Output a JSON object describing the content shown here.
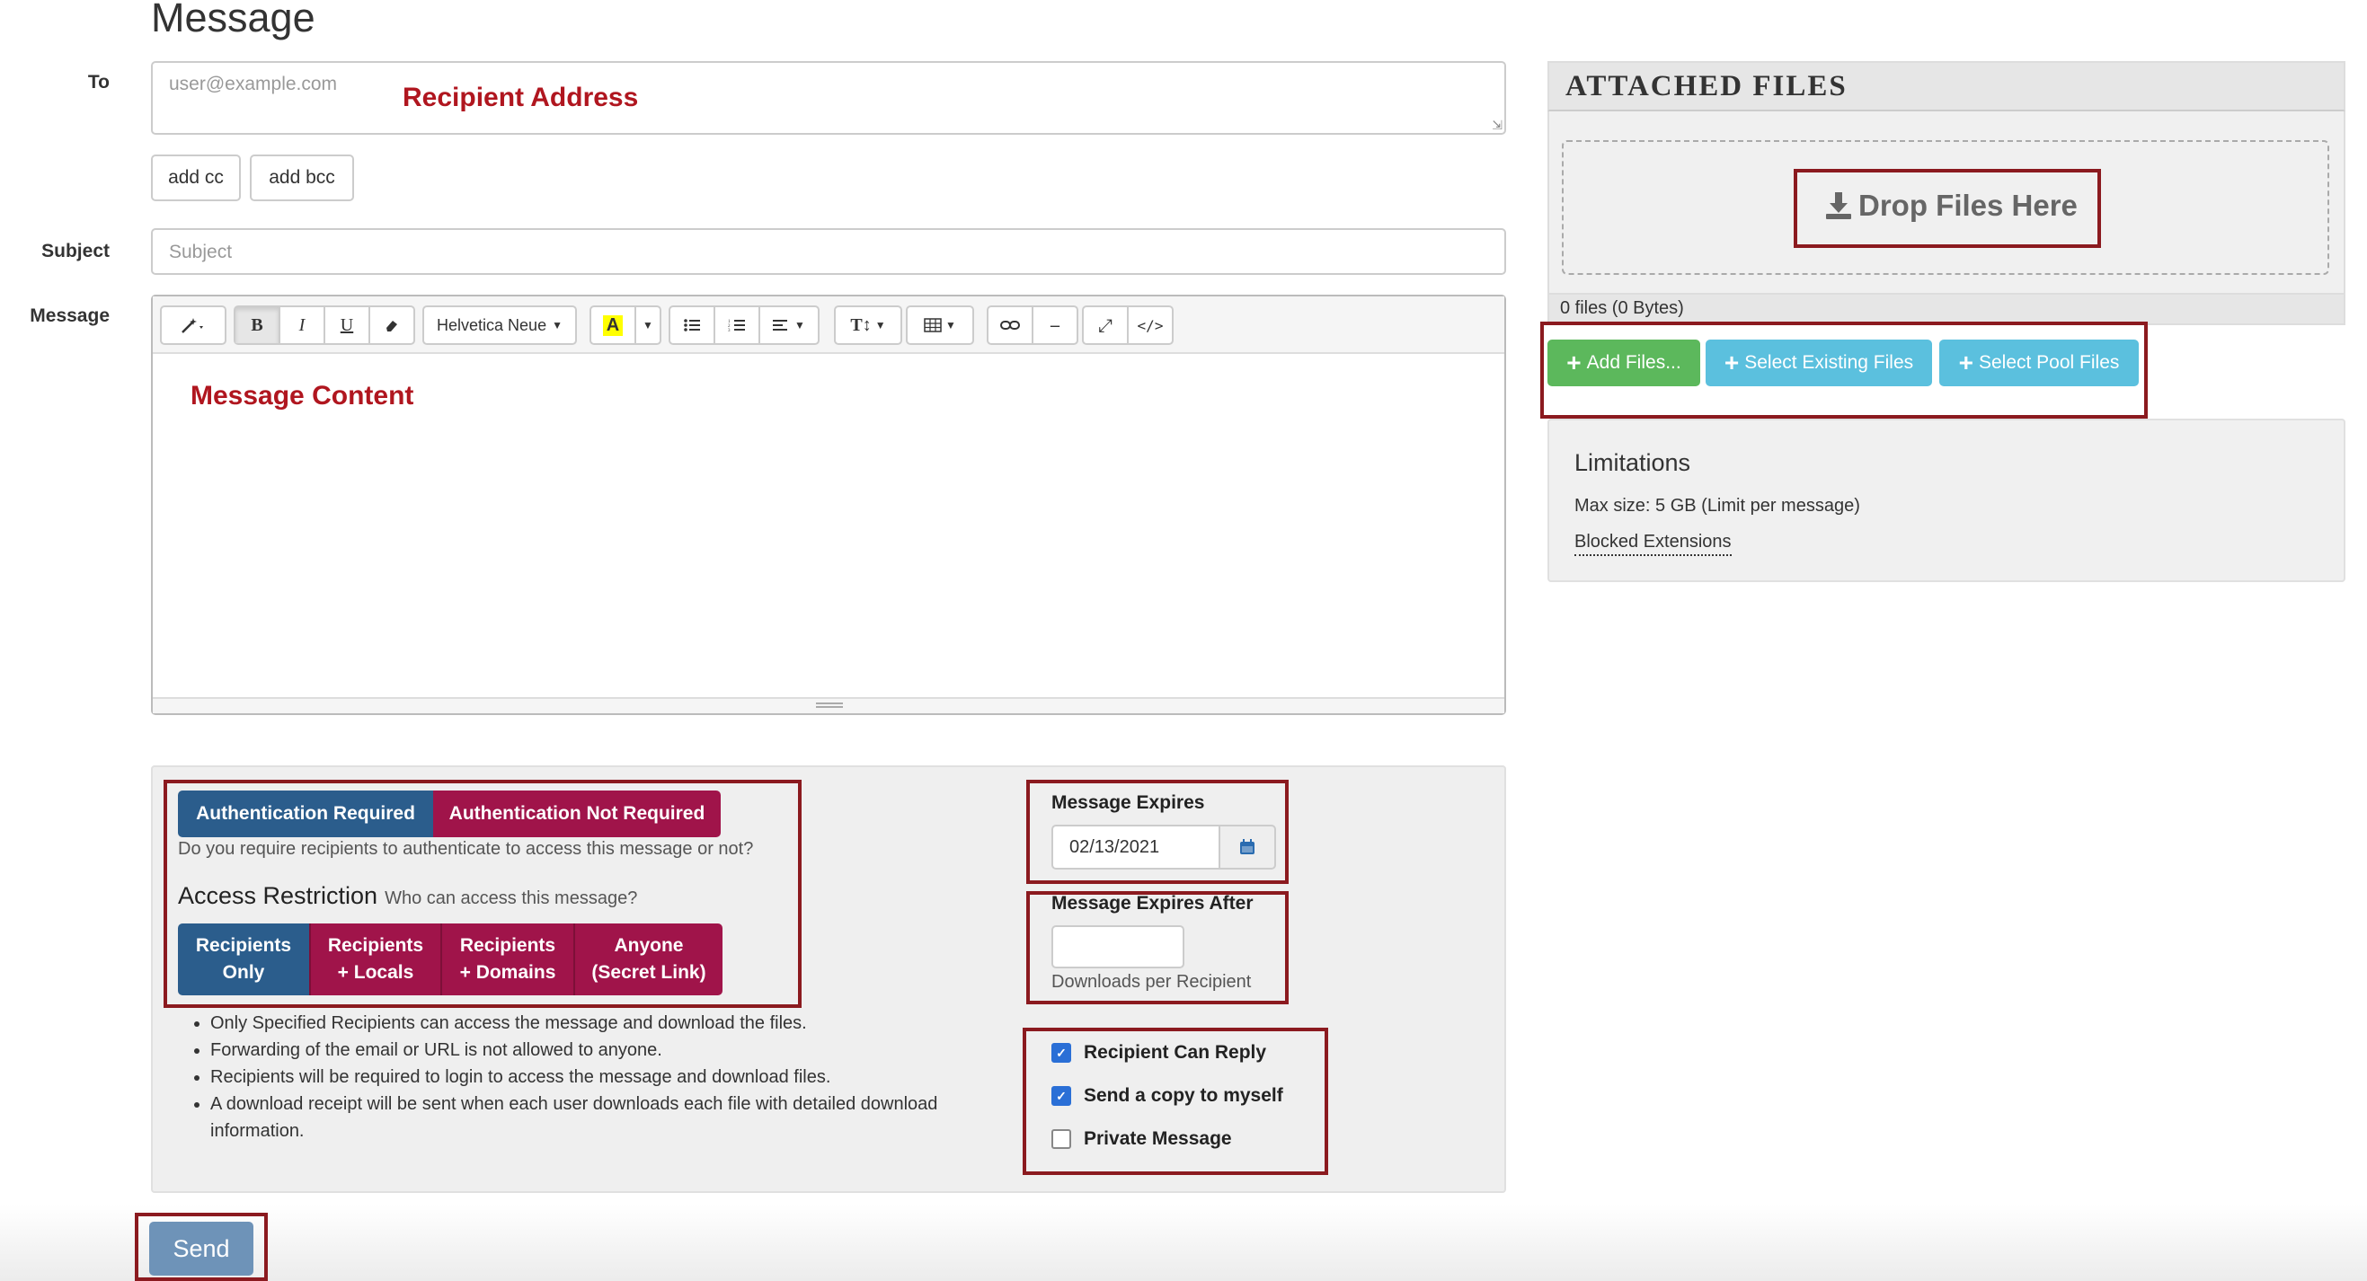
{
  "page": {
    "title": "Message"
  },
  "to": {
    "label": "To",
    "placeholder": "user@example.com",
    "annotation": "Recipient Address"
  },
  "cc_buttons": {
    "add_cc": "add cc",
    "add_bcc": "add bcc"
  },
  "subject": {
    "label": "Subject",
    "placeholder": "Subject"
  },
  "message": {
    "label": "Message",
    "annotation": "Message Content"
  },
  "toolbar": {
    "magic": "magic-wand-icon",
    "bold": "B",
    "italic": "I",
    "underline": "U",
    "eraser": "eraser-icon",
    "font": "Helvetica Neue",
    "color_letter": "A",
    "unordered_list": "unordered-list-icon",
    "ordered_list": "ordered-list-icon",
    "align": "align-icon",
    "text_size": "T↕",
    "table": "table-icon",
    "link": "link-icon",
    "hr": "–",
    "fullscreen": "⤢",
    "code": "</>"
  },
  "auth": {
    "required": "Authentication Required",
    "not_required": "Authentication Not Required",
    "help": "Do you require recipients to authenticate to access this message or not?"
  },
  "access": {
    "title": "Access Restriction",
    "subtitle": "Who can access this message?",
    "options": [
      {
        "line1": "Recipients",
        "line2": "Only"
      },
      {
        "line1": "Recipients",
        "line2": "+ Locals"
      },
      {
        "line1": "Recipients",
        "line2": "+ Domains"
      },
      {
        "line1": "Anyone",
        "line2": "(Secret Link)"
      }
    ],
    "bullets": [
      "Only Specified Recipients can access the message and download the files.",
      "Forwarding of the email or URL is not allowed to anyone.",
      "Recipients will be required to login to access the message and download files.",
      "A download receipt will be sent when each user downloads each file with detailed download information."
    ]
  },
  "expires": {
    "label": "Message Expires",
    "value": "02/13/2021"
  },
  "expires_after": {
    "label": "Message Expires After",
    "value": "",
    "help": "Downloads per Recipient"
  },
  "options": {
    "can_reply": {
      "label": "Recipient Can Reply",
      "checked": true
    },
    "copy_myself": {
      "label": "Send a copy to myself",
      "checked": true
    },
    "private": {
      "label": "Private Message",
      "checked": false
    }
  },
  "send": {
    "label": "Send"
  },
  "attached": {
    "title": "ATTACHED FILES",
    "drop": "Drop Files Here",
    "count": "0 files (0 Bytes)",
    "add_files": "Add Files...",
    "select_existing": "Select Existing Files",
    "select_pool": "Select Pool Files"
  },
  "limitations": {
    "title": "Limitations",
    "max_size": "Max size: 5 GB (Limit per message)",
    "blocked": "Blocked Extensions"
  },
  "colors": {
    "auth_blue": "#2b5d8c",
    "auth_crimson": "#a0144a",
    "add_green": "#5cb85c",
    "info_blue": "#5bc0de",
    "annotation_red": "#b0161f",
    "send_bg": "#6e93b8"
  }
}
